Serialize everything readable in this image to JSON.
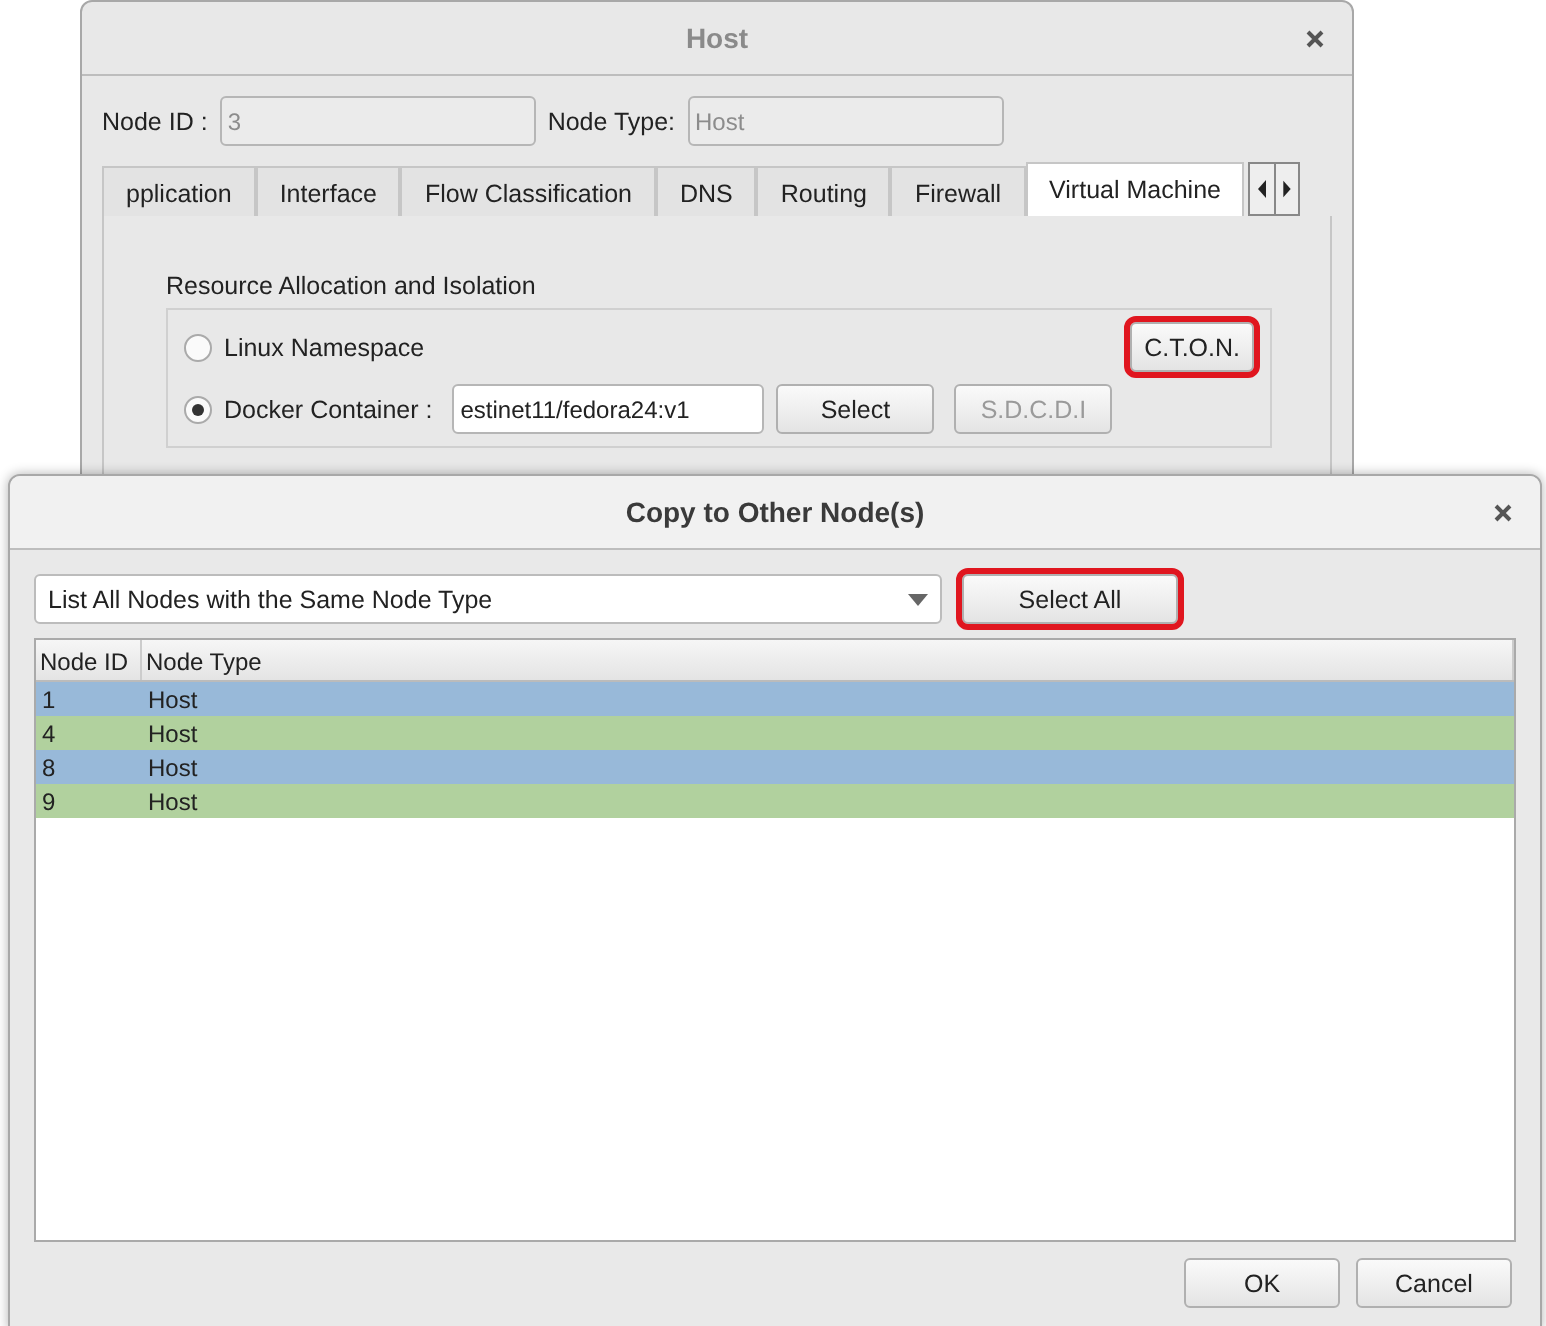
{
  "host_window": {
    "title": "Host",
    "node_id_label": "Node ID :",
    "node_id": "3",
    "node_type_label": "Node Type:",
    "node_type": "Host",
    "tabs": [
      {
        "label": "pplication",
        "selected": false
      },
      {
        "label": "Interface",
        "selected": false
      },
      {
        "label": "Flow Classification",
        "selected": false
      },
      {
        "label": "DNS",
        "selected": false
      },
      {
        "label": "Routing",
        "selected": false
      },
      {
        "label": "Firewall",
        "selected": false
      },
      {
        "label": "Virtual Machine",
        "selected": true
      }
    ],
    "group_title": "Resource Allocation and Isolation",
    "options": [
      {
        "label": "Linux Namespace",
        "selected": false
      },
      {
        "label": "Docker Container :",
        "selected": true
      }
    ],
    "cton_button": {
      "label": "C.T.O.N.",
      "highlighted": true
    },
    "image_field": "estinet11/fedora24:v1",
    "select_button": {
      "label": "Select",
      "disabled": false
    },
    "sdcdi_button": {
      "label": "S.D.C.D.I",
      "disabled": true
    }
  },
  "copy_dialog": {
    "title": "Copy to Other Node(s)",
    "filter": "List All Nodes with the Same Node Type",
    "select_all_button": {
      "label": "Select All",
      "highlighted": true
    },
    "columns": [
      "Node ID",
      "Node Type"
    ],
    "rows": [
      {
        "id": "1",
        "type": "Host",
        "color": "#98b9d9"
      },
      {
        "id": "4",
        "type": "Host",
        "color": "#b1d19e"
      },
      {
        "id": "8",
        "type": "Host",
        "color": "#98b9d9"
      },
      {
        "id": "9",
        "type": "Host",
        "color": "#b1d19e"
      }
    ],
    "buttons": [
      "OK",
      "Cancel"
    ]
  }
}
